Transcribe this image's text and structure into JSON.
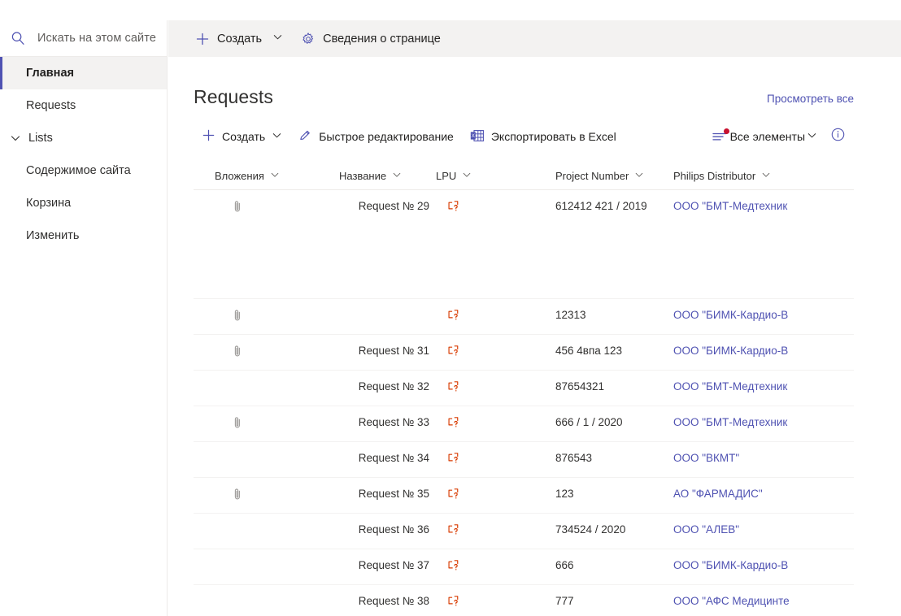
{
  "search": {
    "placeholder": "Искать на этом сайте",
    "icon": "search-icon"
  },
  "sidebar": {
    "items": [
      {
        "label": "Главная",
        "selected": true,
        "group": false
      },
      {
        "label": "Requests",
        "selected": false,
        "group": false
      },
      {
        "label": "Lists",
        "selected": false,
        "group": true,
        "icon": "chevron-down-icon"
      },
      {
        "label": "Содержимое сайта",
        "selected": false,
        "group": false
      },
      {
        "label": "Корзина",
        "selected": false,
        "group": false
      },
      {
        "label": "Изменить",
        "selected": false,
        "group": false
      }
    ]
  },
  "command_bar": {
    "new_label": "Создать",
    "new_icon": "plus-icon",
    "new_chevron": "chevron-down-icon",
    "page_details_label": "Сведения о странице",
    "page_details_icon": "gear-icon"
  },
  "webpart": {
    "title": "Requests",
    "view_all_label": "Просмотреть все"
  },
  "list_toolbar": {
    "new_label": "Создать",
    "new_icon": "plus-icon",
    "new_chevron": "chevron-down-icon",
    "quick_edit_label": "Быстрое редактирование",
    "quick_edit_icon": "pencil-icon",
    "export_label": "Экспортировать в Excel",
    "export_icon": "excel-icon",
    "view_label": "Все элементы",
    "view_icon": "list-view-icon",
    "view_chevron": "chevron-down-icon",
    "info_icon": "info-icon"
  },
  "table": {
    "columns": [
      {
        "label": "Вложения",
        "sort_icon": "chevron-down-icon"
      },
      {
        "label": "Название",
        "sort_icon": "chevron-down-icon"
      },
      {
        "label": "LPU",
        "sort_icon": "chevron-down-icon"
      },
      {
        "label": "Project Number",
        "sort_icon": "chevron-down-icon"
      },
      {
        "label": "Philips Distributor",
        "sort_icon": "chevron-down-icon"
      }
    ],
    "rows": [
      {
        "attachment": true,
        "title": "Request № 29",
        "lpu_icon": "broken-image-icon",
        "project_number": "612412 421 / 2019",
        "distributor": "ООО \"БМТ-Медтехник"
      },
      {
        "attachment": true,
        "title": "",
        "lpu_icon": "broken-image-icon",
        "project_number": "12313",
        "distributor": "ООО \"БИМК-Кардио-В"
      },
      {
        "attachment": true,
        "title": "Request № 31",
        "lpu_icon": "broken-image-icon",
        "project_number": "456 4впа 123",
        "distributor": "ООО \"БИМК-Кардио-В"
      },
      {
        "attachment": false,
        "title": "Request № 32",
        "lpu_icon": "broken-image-icon",
        "project_number": "87654321",
        "distributor": "ООО \"БМТ-Медтехник"
      },
      {
        "attachment": true,
        "title": "Request № 33",
        "lpu_icon": "broken-image-icon",
        "project_number": "666 / 1 / 2020",
        "distributor": "ООО \"БМТ-Медтехник"
      },
      {
        "attachment": false,
        "title": "Request № 34",
        "lpu_icon": "broken-image-icon",
        "project_number": "876543",
        "distributor": "ООО \"ВКМТ\""
      },
      {
        "attachment": true,
        "title": "Request № 35",
        "lpu_icon": "broken-image-icon",
        "project_number": "123",
        "distributor": "АО \"ФАРМАДИС\""
      },
      {
        "attachment": false,
        "title": "Request № 36",
        "lpu_icon": "broken-image-icon",
        "project_number": "734524 / 2020",
        "distributor": "ООО \"АЛЕВ\""
      },
      {
        "attachment": false,
        "title": "Request № 37",
        "lpu_icon": "broken-image-icon",
        "project_number": "666",
        "distributor": "ООО \"БИМК-Кардио-В"
      },
      {
        "attachment": false,
        "title": "Request № 38",
        "lpu_icon": "broken-image-icon",
        "project_number": "777",
        "distributor": "ООО \"АФС Медицинте"
      }
    ]
  },
  "colors": {
    "accent": "#4f52b2",
    "badge_red": "#c8102e",
    "lpu_icon": "#d83b01",
    "command_bar_bg": "#f3f2f1",
    "selected_nav_bg": "#f3f2f1",
    "divider": "#edebe9"
  }
}
